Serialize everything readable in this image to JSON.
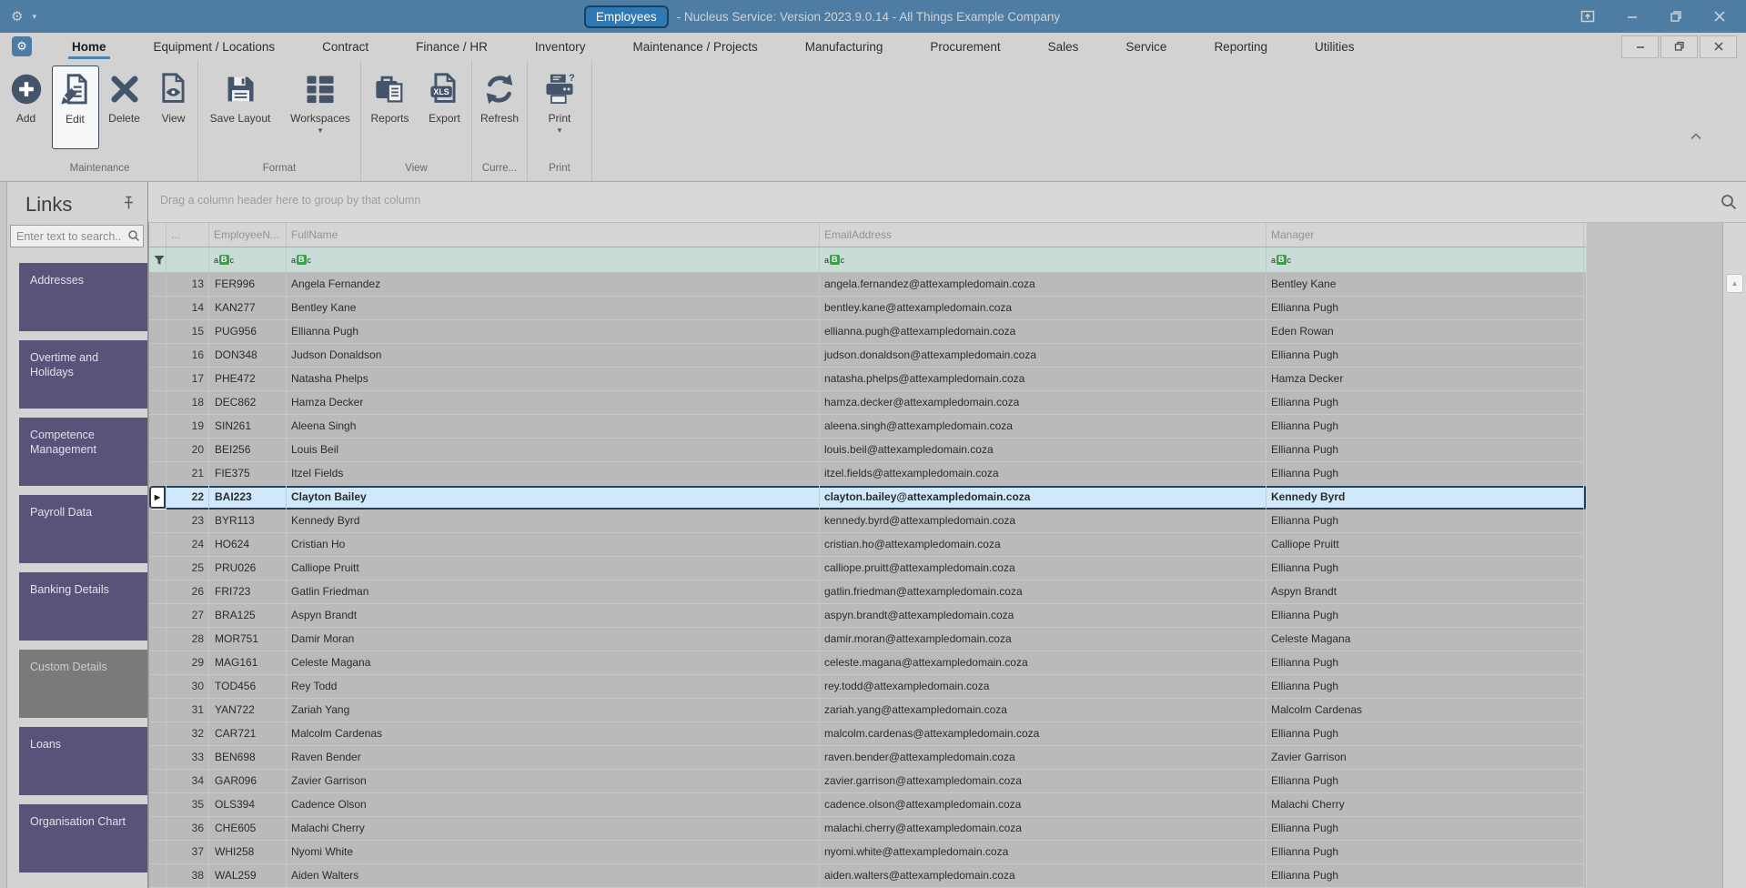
{
  "title_bar": {
    "badge": "Employees",
    "title_rest": "- Nucleus Service: Version 2023.9.0.14 - All Things Example Company"
  },
  "tabs": [
    {
      "label": "Home",
      "selected": true
    },
    {
      "label": "Equipment / Locations"
    },
    {
      "label": "Contract"
    },
    {
      "label": "Finance / HR"
    },
    {
      "label": "Inventory"
    },
    {
      "label": "Maintenance / Projects"
    },
    {
      "label": "Manufacturing"
    },
    {
      "label": "Procurement"
    },
    {
      "label": "Sales"
    },
    {
      "label": "Service"
    },
    {
      "label": "Reporting"
    },
    {
      "label": "Utilities"
    }
  ],
  "ribbon": {
    "buttons": {
      "add": "Add",
      "edit": "Edit",
      "delete": "Delete",
      "view": "View",
      "save_layout": "Save Layout",
      "workspaces": "Workspaces",
      "reports": "Reports",
      "export": "Export",
      "refresh": "Refresh",
      "print": "Print"
    },
    "export_badge": "XLS",
    "group_captions": {
      "maintenance": "Maintenance",
      "format": "Format",
      "view": "View",
      "current": "Curre...",
      "print": "Print"
    }
  },
  "links_panel": {
    "title": "Links",
    "search_placeholder": "Enter text to search..",
    "items": [
      {
        "label": "Addresses"
      },
      {
        "label": "Overtime and Holidays"
      },
      {
        "label": "Competence Management"
      },
      {
        "label": "Payroll Data"
      },
      {
        "label": "Banking Details"
      },
      {
        "label": "Custom Details",
        "variant": "gray"
      },
      {
        "label": "Loans"
      },
      {
        "label": "Organisation Chart"
      }
    ]
  },
  "grid": {
    "groupby_hint": "Drag a column header here to group by that column",
    "columns": {
      "num": "...",
      "employee": "EmployeeN...",
      "fullname": "FullName",
      "email": "EmailAddress",
      "manager": "Manager"
    },
    "rows": [
      {
        "num": "13",
        "code": "FER996",
        "name": "Angela Fernandez",
        "email": "angela.fernandez@attexampledomain.coza",
        "manager": "Bentley Kane"
      },
      {
        "num": "14",
        "code": "KAN277",
        "name": "Bentley Kane",
        "email": "bentley.kane@attexampledomain.coza",
        "manager": "Ellianna Pugh"
      },
      {
        "num": "15",
        "code": "PUG956",
        "name": "Ellianna Pugh",
        "email": "ellianna.pugh@attexampledomain.coza",
        "manager": "Eden Rowan"
      },
      {
        "num": "16",
        "code": "DON348",
        "name": "Judson Donaldson",
        "email": "judson.donaldson@attexampledomain.coza",
        "manager": "Ellianna Pugh"
      },
      {
        "num": "17",
        "code": "PHE472",
        "name": "Natasha Phelps",
        "email": "natasha.phelps@attexampledomain.coza",
        "manager": "Hamza Decker"
      },
      {
        "num": "18",
        "code": "DEC862",
        "name": "Hamza Decker",
        "email": "hamza.decker@attexampledomain.coza",
        "manager": "Ellianna Pugh"
      },
      {
        "num": "19",
        "code": "SIN261",
        "name": "Aleena Singh",
        "email": "aleena.singh@attexampledomain.coza",
        "manager": "Ellianna Pugh"
      },
      {
        "num": "20",
        "code": "BEI256",
        "name": "Louis Beil",
        "email": "louis.beil@attexampledomain.coza",
        "manager": "Ellianna Pugh"
      },
      {
        "num": "21",
        "code": "FIE375",
        "name": "Itzel Fields",
        "email": "itzel.fields@attexampledomain.coza",
        "manager": "Ellianna Pugh"
      },
      {
        "num": "22",
        "code": "BAI223",
        "name": "Clayton Bailey",
        "email": "clayton.bailey@attexampledomain.coza",
        "manager": "Kennedy Byrd",
        "selected": true
      },
      {
        "num": "23",
        "code": "BYR113",
        "name": "Kennedy Byrd",
        "email": "kennedy.byrd@attexampledomain.coza",
        "manager": "Ellianna Pugh"
      },
      {
        "num": "24",
        "code": "HO624",
        "name": "Cristian Ho",
        "email": "cristian.ho@attexampledomain.coza",
        "manager": "Calliope Pruitt"
      },
      {
        "num": "25",
        "code": "PRU026",
        "name": "Calliope Pruitt",
        "email": "calliope.pruitt@attexampledomain.coza",
        "manager": "Ellianna Pugh"
      },
      {
        "num": "26",
        "code": "FRI723",
        "name": "Gatlin Friedman",
        "email": "gatlin.friedman@attexampledomain.coza",
        "manager": "Aspyn Brandt"
      },
      {
        "num": "27",
        "code": "BRA125",
        "name": "Aspyn Brandt",
        "email": "aspyn.brandt@attexampledomain.coza",
        "manager": "Ellianna Pugh"
      },
      {
        "num": "28",
        "code": "MOR751",
        "name": "Damir Moran",
        "email": "damir.moran@attexampledomain.coza",
        "manager": "Celeste Magana"
      },
      {
        "num": "29",
        "code": "MAG161",
        "name": "Celeste Magana",
        "email": "celeste.magana@attexampledomain.coza",
        "manager": "Ellianna Pugh"
      },
      {
        "num": "30",
        "code": "TOD456",
        "name": "Rey Todd",
        "email": "rey.todd@attexampledomain.coza",
        "manager": "Ellianna Pugh"
      },
      {
        "num": "31",
        "code": "YAN722",
        "name": "Zariah Yang",
        "email": "zariah.yang@attexampledomain.coza",
        "manager": "Malcolm Cardenas"
      },
      {
        "num": "32",
        "code": "CAR721",
        "name": "Malcolm Cardenas",
        "email": "malcolm.cardenas@attexampledomain.coza",
        "manager": "Ellianna Pugh"
      },
      {
        "num": "33",
        "code": "BEN698",
        "name": "Raven Bender",
        "email": "raven.bender@attexampledomain.coza",
        "manager": "Zavier Garrison"
      },
      {
        "num": "34",
        "code": "GAR096",
        "name": "Zavier Garrison",
        "email": "zavier.garrison@attexampledomain.coza",
        "manager": "Ellianna Pugh"
      },
      {
        "num": "35",
        "code": "OLS394",
        "name": "Cadence Olson",
        "email": "cadence.olson@attexampledomain.coza",
        "manager": "Malachi Cherry"
      },
      {
        "num": "36",
        "code": "CHE605",
        "name": "Malachi Cherry",
        "email": "malachi.cherry@attexampledomain.coza",
        "manager": "Ellianna Pugh"
      },
      {
        "num": "37",
        "code": "WHI258",
        "name": "Nyomi White",
        "email": "nyomi.white@attexampledomain.coza",
        "manager": "Ellianna Pugh"
      },
      {
        "num": "38",
        "code": "WAL259",
        "name": "Aiden Walters",
        "email": "aiden.walters@attexampledomain.coza",
        "manager": "Ellianna Pugh"
      }
    ]
  },
  "colors": {
    "titlebar": "#4E7CA3",
    "badge": "#3078B2",
    "icon": "#44546A",
    "sidebar_button": "#575379",
    "filter_row": "#C9DCD7",
    "selection_fill": "#CFE9FB",
    "selection_border": "#2B3B52",
    "abc_green": "#3F9E49"
  }
}
